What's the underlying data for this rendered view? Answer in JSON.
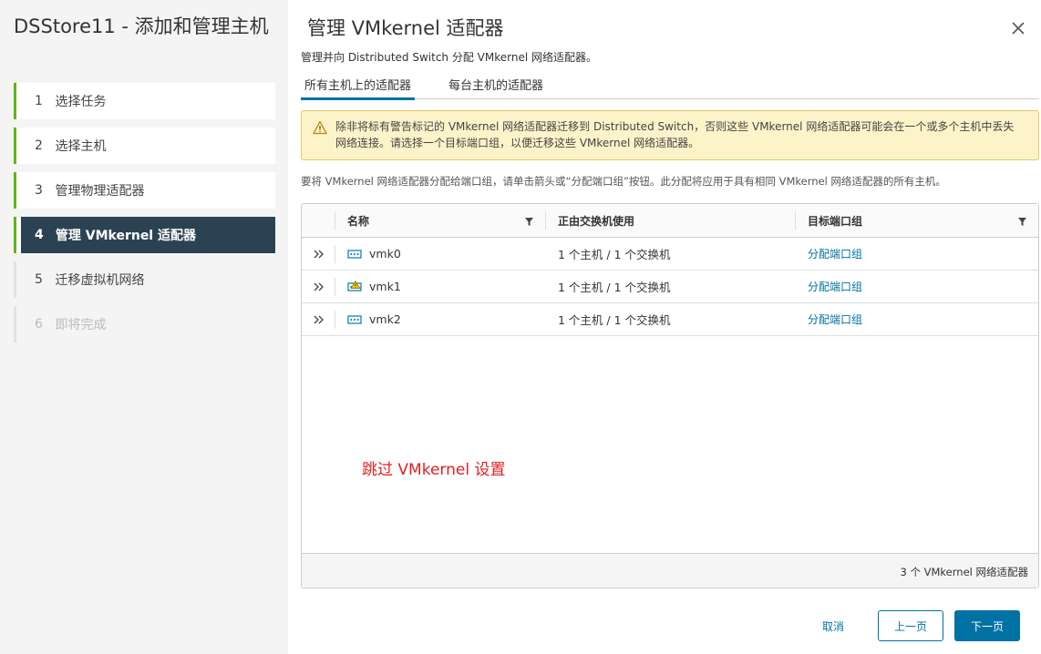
{
  "sidebar": {
    "title": "DSStore11 - 添加和管理主机",
    "steps": [
      {
        "num": "1",
        "label": "选择任务",
        "state": "done"
      },
      {
        "num": "2",
        "label": "选择主机",
        "state": "done"
      },
      {
        "num": "3",
        "label": "管理物理适配器",
        "state": "done"
      },
      {
        "num": "4",
        "label": "管理 VMkernel 适配器",
        "state": "current"
      },
      {
        "num": "5",
        "label": "迁移虚拟机网络",
        "state": "upcoming"
      },
      {
        "num": "6",
        "label": "即将完成",
        "state": "disabled"
      }
    ]
  },
  "main": {
    "title": "管理 VMkernel 适配器",
    "subtitle": "管理并向 Distributed Switch 分配 VMkernel 网络适配器。",
    "tabs": [
      {
        "label": "所有主机上的适配器",
        "active": true
      },
      {
        "label": "每台主机的适配器",
        "active": false
      }
    ],
    "warning": "除非将标有警告标记的 VMkernel 网络适配器迁移到 Distributed Switch，否则这些 VMkernel 网络适配器可能会在一个或多个主机中丢失网络连接。请选择一个目标端口组，以便迁移这些 VMkernel 网络适配器。",
    "info": "要将 VMkernel 网络适配器分配给端口组，请单击箭头或“分配端口组”按钮。此分配将应用于具有相同 VMkernel 网络适配器的所有主机。",
    "grid": {
      "columns": [
        "名称",
        "正由交换机使用",
        "目标端口组"
      ],
      "rows": [
        {
          "name": "vmk0",
          "used_by": "1 个主机 / 1 个交换机",
          "target": "分配端口组",
          "warning": false
        },
        {
          "name": "vmk1",
          "used_by": "1 个主机 / 1 个交换机",
          "target": "分配端口组",
          "warning": true
        },
        {
          "name": "vmk2",
          "used_by": "1 个主机 / 1 个交换机",
          "target": "分配端口组",
          "warning": false
        }
      ],
      "annotation": "跳过 VMkernel 设置",
      "footer": "3 个 VMkernel 网络适配器"
    },
    "buttons": {
      "cancel": "取消",
      "back": "上一页",
      "next": "下一页"
    }
  },
  "colors": {
    "accent": "#0072a3",
    "current_step_bg": "#2b4253",
    "done_marker": "#60b515",
    "warning_bg": "#fdf3c9",
    "annotation": "#e02020"
  }
}
